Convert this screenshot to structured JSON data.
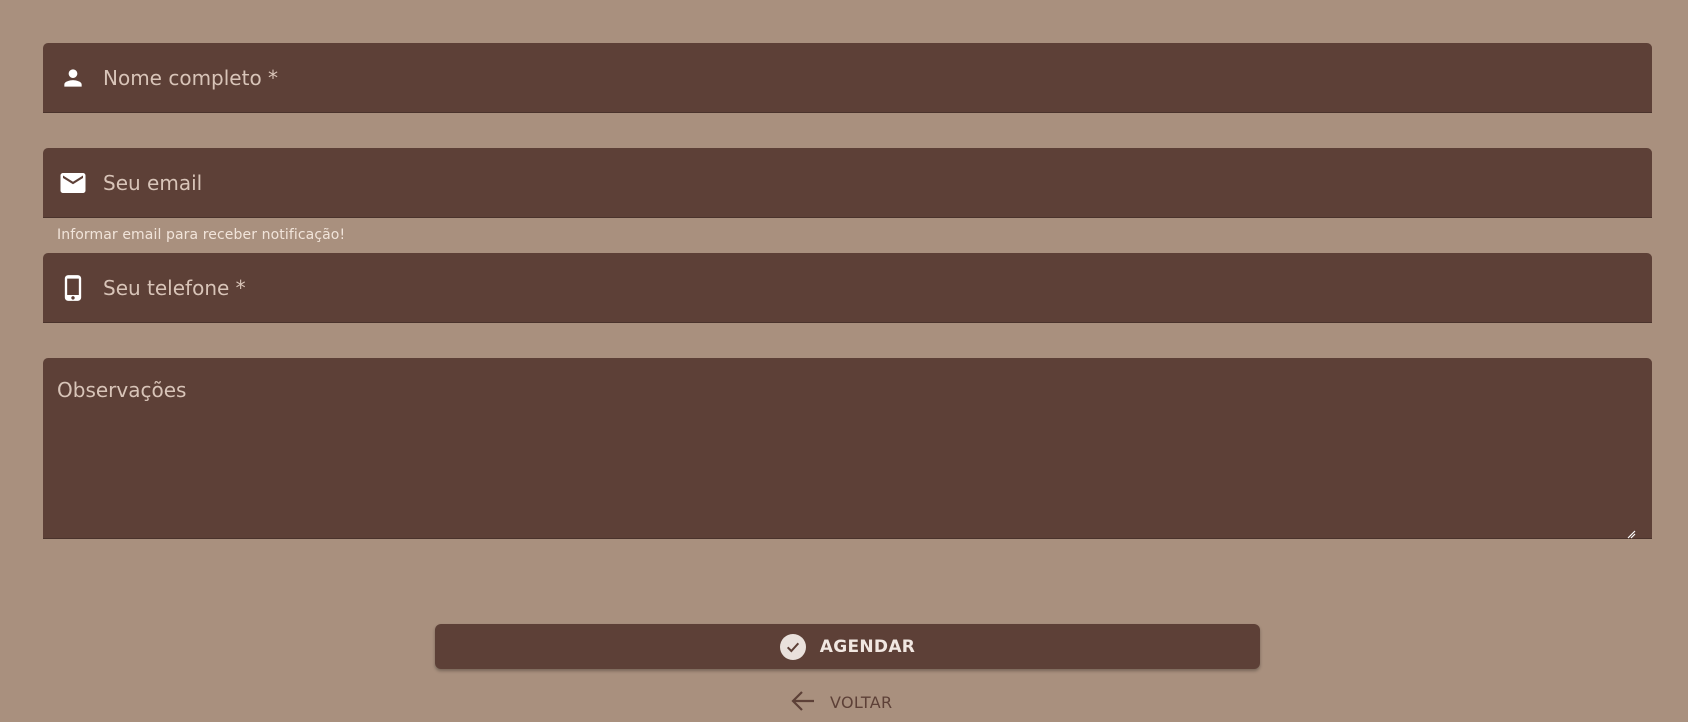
{
  "form": {
    "name_field": {
      "placeholder": "Nome completo *",
      "value": "",
      "icon": "person-icon"
    },
    "email_field": {
      "placeholder": "Seu email",
      "value": "",
      "icon": "email-icon",
      "hint": "Informar email para receber notificação!"
    },
    "phone_field": {
      "placeholder": "Seu telefone *",
      "value": "",
      "icon": "smartphone-icon"
    },
    "notes_field": {
      "placeholder": "Observações",
      "value": ""
    },
    "submit_button": {
      "label": "AGENDAR",
      "icon": "check-circle-icon"
    },
    "back_button": {
      "label": "VOLTAR",
      "icon": "arrow-left-icon"
    }
  },
  "colors": {
    "background": "#a9907e",
    "field_background": "#5d4037",
    "text_light": "#ecdcd2",
    "accent": "#5d4037"
  }
}
